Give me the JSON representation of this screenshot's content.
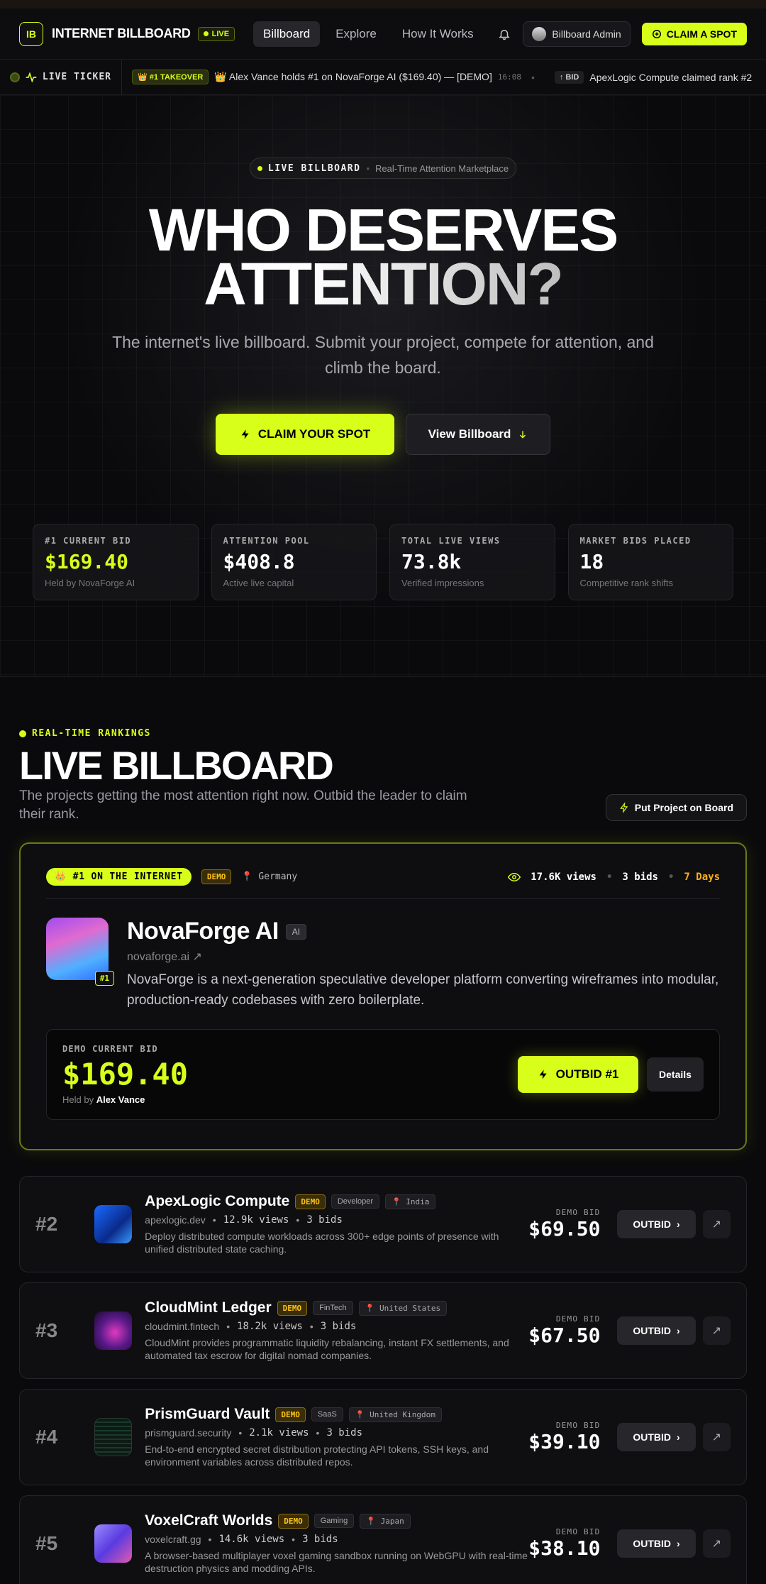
{
  "nav": {
    "logo": "IB",
    "brand": "INTERNET BILLBOARD",
    "live_badge": "LIVE",
    "links": [
      "Billboard",
      "Explore",
      "How It Works"
    ],
    "admin_label": "Billboard Admin",
    "claim_label": "CLAIM A SPOT"
  },
  "ticker": {
    "label": "LIVE TICKER",
    "item1_tag": "👑 #1 TAKEOVER",
    "item1_text": "👑 Alex Vance holds #1 on NovaForge AI ($169.40) — [DEMO]",
    "item1_time": "16:08",
    "item2_tag": "↑ BID",
    "item2_text": "ApexLogic Compute claimed rank #2"
  },
  "hero": {
    "pill_main": "LIVE BILLBOARD",
    "pill_sub": "Real-Time Attention Marketplace",
    "title_line1": "WHO DESERVES",
    "title_line2": "ATTENTION?",
    "subtitle": "The internet's live billboard. Submit your project, compete for attention, and climb the board.",
    "primary_cta": "CLAIM YOUR SPOT",
    "secondary_cta": "View Billboard"
  },
  "stats": [
    {
      "label": "#1 CURRENT BID",
      "value": "$169.40",
      "sub": "Held by NovaForge AI"
    },
    {
      "label": "ATTENTION POOL",
      "value": "$408.8",
      "sub": "Active live capital"
    },
    {
      "label": "TOTAL LIVE VIEWS",
      "value": "73.8k",
      "sub": "Verified impressions"
    },
    {
      "label": "MARKET BIDS PLACED",
      "value": "18",
      "sub": "Competitive rank shifts"
    }
  ],
  "rankings": {
    "eyebrow": "REAL-TIME RANKINGS",
    "title": "LIVE BILLBOARD",
    "subtitle": "The projects getting the most attention right now. Outbid the leader to claim their rank.",
    "put_button": "Put Project on Board"
  },
  "leader": {
    "crown": "👑 #1 ON THE INTERNET",
    "demo": "DEMO",
    "location": "📍 Germany",
    "views": "17.6K views",
    "bids": "3 bids",
    "days": "7 Days",
    "name": "NovaForge AI",
    "tag": "AI",
    "domain": "novaforge.ai ↗",
    "rank": "#1",
    "desc": "NovaForge is a next-generation speculative developer platform converting wireframes into modular, production-ready codebases with zero boilerplate.",
    "bid_label": "DEMO CURRENT BID",
    "bid_value": "$169.40",
    "held_prefix": "Held by",
    "held_by": "Alex Vance",
    "outbid_label": "OUTBID #1",
    "details_label": "Details"
  },
  "rows": [
    {
      "rank": "#2",
      "name": "ApexLogic Compute",
      "demo": "DEMO",
      "category": "Developer",
      "location": "📍 India",
      "domain": "apexlogic.dev",
      "views": "12.9k views",
      "bids": "3 bids",
      "desc": "Deploy distributed compute workloads across 300+ edge points of presence with unified distributed state caching.",
      "bid_label": "DEMO BID",
      "bid": "$69.50",
      "outbid": "OUTBID"
    },
    {
      "rank": "#3",
      "name": "CloudMint Ledger",
      "demo": "DEMO",
      "category": "FinTech",
      "location": "📍 United States",
      "domain": "cloudmint.fintech",
      "views": "18.2k views",
      "bids": "3 bids",
      "desc": "CloudMint provides programmatic liquidity rebalancing, instant FX settlements, and automated tax escrow for digital nomad companies.",
      "bid_label": "DEMO BID",
      "bid": "$67.50",
      "outbid": "OUTBID"
    },
    {
      "rank": "#4",
      "name": "PrismGuard Vault",
      "demo": "DEMO",
      "category": "SaaS",
      "location": "📍 United Kingdom",
      "domain": "prismguard.security",
      "views": "2.1k views",
      "bids": "3 bids",
      "desc": "End-to-end encrypted secret distribution protecting API tokens, SSH keys, and environment variables across distributed repos.",
      "bid_label": "DEMO BID",
      "bid": "$39.10",
      "outbid": "OUTBID"
    },
    {
      "rank": "#5",
      "name": "VoxelCraft Worlds",
      "demo": "DEMO",
      "category": "Gaming",
      "location": "📍 Japan",
      "domain": "voxelcraft.gg",
      "views": "14.6k views",
      "bids": "3 bids",
      "desc": "A browser-based multiplayer voxel gaming sandbox running on WebGPU with real-time destruction physics and modding APIs.",
      "bid_label": "DEMO BID",
      "bid": "$38.10",
      "outbid": "OUTBID"
    }
  ]
}
